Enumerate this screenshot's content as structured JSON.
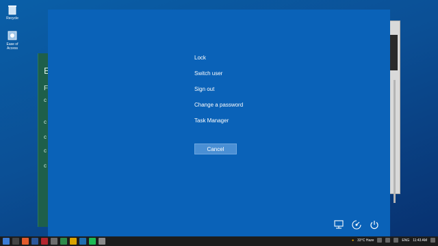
{
  "desktop": {
    "icons": [
      {
        "label": "Recycle"
      },
      {
        "label": "Ease of Access"
      }
    ]
  },
  "background_window": {
    "letters": [
      "E",
      "F",
      "c",
      "c",
      "c",
      "c",
      "c"
    ]
  },
  "security_screen": {
    "menu": [
      {
        "label": "Lock"
      },
      {
        "label": "Switch user"
      },
      {
        "label": "Sign out"
      },
      {
        "label": "Change a password"
      },
      {
        "label": "Task Manager"
      }
    ],
    "cancel_label": "Cancel",
    "corner_icons": [
      "network-icon",
      "ease-of-access-icon",
      "power-icon"
    ]
  },
  "taskbar": {
    "weather": "33°C Haze",
    "language": "ENG",
    "time": "11:43 AM"
  },
  "colors": {
    "overlay": "#0a62b8",
    "desktop_top": "#0a5fa8",
    "taskbar": "#1c1c1c"
  }
}
